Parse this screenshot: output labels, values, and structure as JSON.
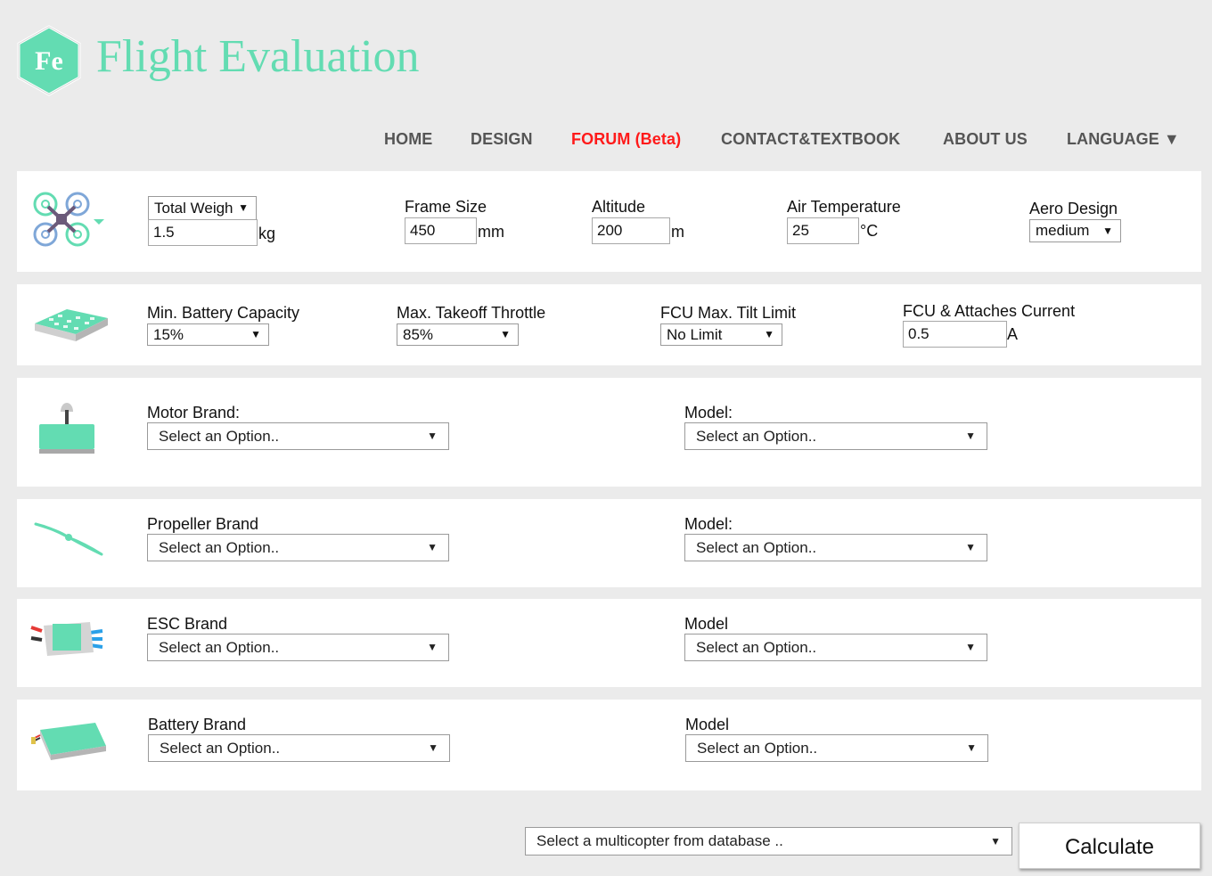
{
  "header": {
    "logo_text": "Fe",
    "title": "Flight Evaluation",
    "brand_color": "#63dcb2"
  },
  "nav": {
    "items": [
      {
        "label": "HOME"
      },
      {
        "label": "DESIGN"
      },
      {
        "label": "FORUM (Beta)",
        "active": true
      },
      {
        "label": "CONTACT&TEXTBOOK"
      },
      {
        "label": "ABOUT US"
      },
      {
        "label": "LANGUAGE ▼"
      }
    ]
  },
  "general": {
    "weight_mode": "Total Weigh",
    "weight_value": "1.5",
    "weight_unit": "kg",
    "frame_label": "Frame Size",
    "frame_value": "450",
    "frame_unit": "mm",
    "altitude_label": "Altitude",
    "altitude_value": "200",
    "altitude_unit": "m",
    "temp_label": "Air Temperature",
    "temp_value": "25",
    "temp_unit": "°C",
    "aero_label": "Aero Design",
    "aero_value": "medium"
  },
  "battery_settings": {
    "min_capacity_label": "Min. Battery Capacity",
    "min_capacity_value": "15%",
    "takeoff_label": "Max. Takeoff Throttle",
    "takeoff_value": "85%",
    "tilt_label": "FCU Max. Tilt Limit",
    "tilt_value": "No Limit",
    "current_label": "FCU & Attaches Current",
    "current_value": "0.5",
    "current_unit": "A"
  },
  "components": {
    "motor": {
      "brand_label": "Motor Brand:",
      "brand_value": "Select an Option..",
      "model_label": "Model:",
      "model_value": "Select an Option.."
    },
    "propeller": {
      "brand_label": "Propeller Brand",
      "brand_value": "Select an Option..",
      "model_label": "Model:",
      "model_value": "Select an Option.."
    },
    "esc": {
      "brand_label": "ESC Brand",
      "brand_value": "Select an Option..",
      "model_label": "Model",
      "model_value": "Select an Option.."
    },
    "battery": {
      "brand_label": "Battery Brand",
      "brand_value": "Select an Option..",
      "model_label": "Model",
      "model_value": "Select an Option.."
    }
  },
  "footer": {
    "database_value": "Select a multicopter from database ..",
    "calculate_label": "Calculate"
  },
  "icons": {
    "logo": "hexagon-logo-icon",
    "frame": "quadcopter-icon",
    "battery_pack": "battery-board-icon",
    "motor": "motor-icon",
    "propeller": "propeller-icon",
    "esc": "esc-icon",
    "battery": "lipo-battery-icon"
  }
}
